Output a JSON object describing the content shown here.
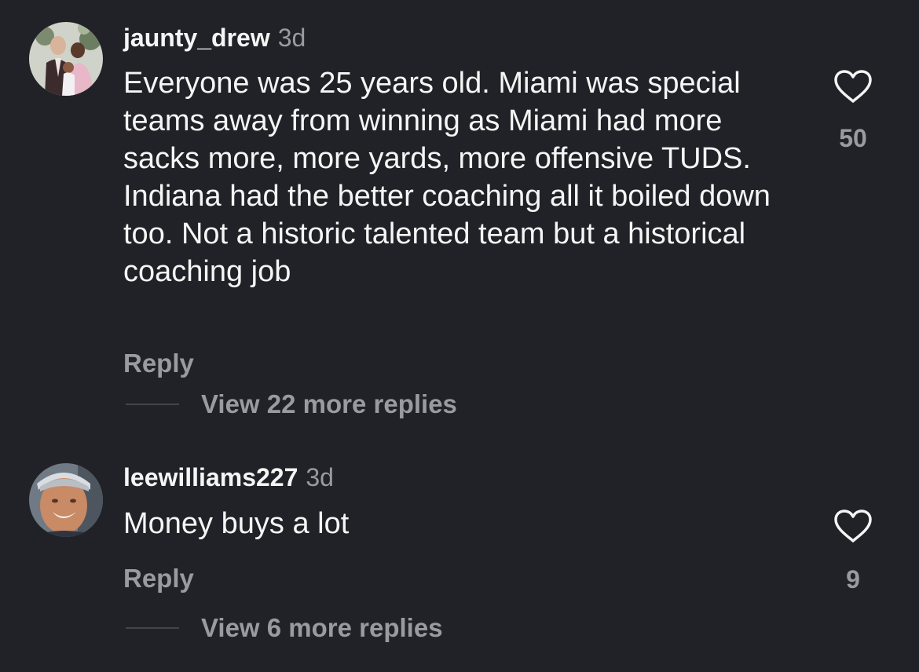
{
  "comments": [
    {
      "username": "jaunty_drew",
      "time": "3d",
      "text": "Everyone was 25 years old. Miami was special teams away from winning as Miami had more sacks more, more yards, more offensive TUDS. Indiana had the better coaching all it boiled down too. Not a historic talented team but a historical coaching job",
      "reply_label": "Reply",
      "view_replies_label": "View 22 more replies",
      "like_count": "50",
      "like_icon": "heart-outline-icon"
    },
    {
      "username": "leewilliams227",
      "time": "3d",
      "text": "Money buys a lot",
      "reply_label": "Reply",
      "view_replies_label": "View 6 more replies",
      "like_count": "9",
      "like_icon": "heart-outline-icon"
    }
  ],
  "colors": {
    "background": "#212227",
    "primary_text": "#f5f5f5",
    "secondary_text": "#9a9ba0"
  }
}
